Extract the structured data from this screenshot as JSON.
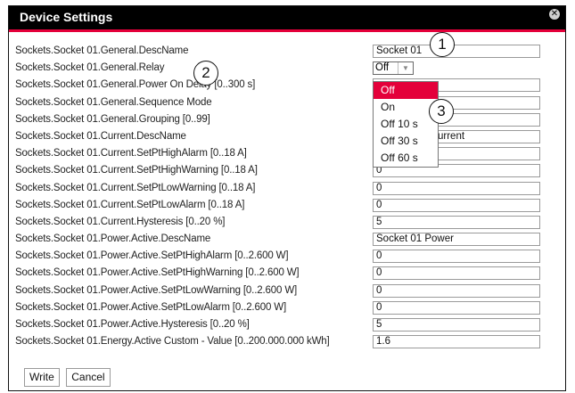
{
  "dialog": {
    "title": "Device Settings"
  },
  "rows": [
    {
      "label": "Sockets.Socket 01.General.DescName",
      "value": "Socket 01"
    },
    {
      "label": "Sockets.Socket 01.General.Relay",
      "value": "Off"
    },
    {
      "label": "Sockets.Socket 01.General.Power On Delay [0..300 s]",
      "value": ""
    },
    {
      "label": "Sockets.Socket 01.General.Sequence Mode",
      "value": ""
    },
    {
      "label": "Sockets.Socket 01.General.Grouping [0..99]",
      "value": ""
    },
    {
      "label": "Sockets.Socket 01.Current.DescName",
      "value": "urrent"
    },
    {
      "label": "Sockets.Socket 01.Current.SetPtHighAlarm [0..18 A]",
      "value": ""
    },
    {
      "label": "Sockets.Socket 01.Current.SetPtHighWarning [0..18 A]",
      "value": "0"
    },
    {
      "label": "Sockets.Socket 01.Current.SetPtLowWarning [0..18 A]",
      "value": "0"
    },
    {
      "label": "Sockets.Socket 01.Current.SetPtLowAlarm [0..18 A]",
      "value": "0"
    },
    {
      "label": "Sockets.Socket 01.Current.Hysteresis [0..20 %]",
      "value": "5"
    },
    {
      "label": "Sockets.Socket 01.Power.Active.DescName",
      "value": "Socket 01 Power"
    },
    {
      "label": "Sockets.Socket 01.Power.Active.SetPtHighAlarm [0..2.600 W]",
      "value": "0"
    },
    {
      "label": "Sockets.Socket 01.Power.Active.SetPtHighWarning [0..2.600 W]",
      "value": "0"
    },
    {
      "label": "Sockets.Socket 01.Power.Active.SetPtLowWarning [0..2.600 W]",
      "value": "0"
    },
    {
      "label": "Sockets.Socket 01.Power.Active.SetPtLowAlarm [0..2.600 W]",
      "value": "0"
    },
    {
      "label": "Sockets.Socket 01.Power.Active.Hysteresis [0..20 %]",
      "value": "5"
    },
    {
      "label": "Sockets.Socket 01.Energy.Active Custom - Value [0..200.000.000 kWh]",
      "value": "1.6"
    }
  ],
  "relay_dropdown": {
    "selected": "Off",
    "options": [
      "Off",
      "On",
      "Off 10 s",
      "Off 30 s",
      "Off 60 s"
    ]
  },
  "buttons": {
    "write": "Write",
    "cancel": "Cancel"
  },
  "callouts": [
    "1",
    "2",
    "3"
  ],
  "colors": {
    "accent": "#e4003a",
    "titlebar": "#000000"
  }
}
